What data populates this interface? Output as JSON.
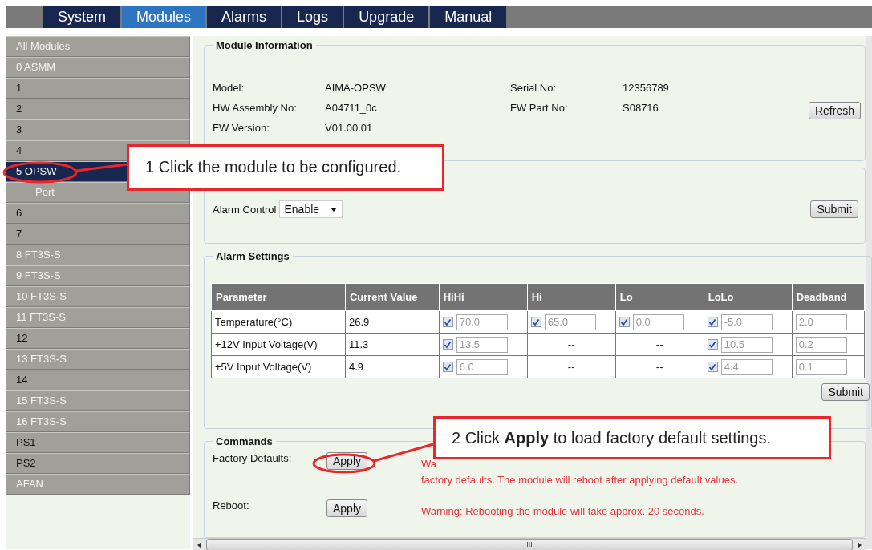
{
  "tabs": [
    {
      "label": "System",
      "selected": false
    },
    {
      "label": "Modules",
      "selected": true
    },
    {
      "label": "Alarms",
      "selected": false
    },
    {
      "label": "Logs",
      "selected": false
    },
    {
      "label": "Upgrade",
      "selected": false
    },
    {
      "label": "Manual",
      "selected": false
    }
  ],
  "sidebar": {
    "items": [
      {
        "label": "All Modules",
        "present": true,
        "selected": false
      },
      {
        "label": "0 ASMM",
        "present": true,
        "selected": false
      },
      {
        "label": "1",
        "present": false,
        "selected": false
      },
      {
        "label": "2",
        "present": false,
        "selected": false
      },
      {
        "label": "3",
        "present": false,
        "selected": false
      },
      {
        "label": "4",
        "present": false,
        "selected": false
      },
      {
        "label": "5 OPSW",
        "present": true,
        "selected": true,
        "children": [
          {
            "label": "Port",
            "present": true,
            "selected": false
          }
        ]
      },
      {
        "label": "6",
        "present": false,
        "selected": false
      },
      {
        "label": "7",
        "present": false,
        "selected": false
      },
      {
        "label": "8 FT3S-S",
        "present": true,
        "selected": false
      },
      {
        "label": "9 FT3S-S",
        "present": true,
        "selected": false
      },
      {
        "label": "10 FT3S-S",
        "present": true,
        "selected": false
      },
      {
        "label": "11 FT3S-S",
        "present": true,
        "selected": false
      },
      {
        "label": "12",
        "present": false,
        "selected": false
      },
      {
        "label": "13 FT3S-S",
        "present": true,
        "selected": false
      },
      {
        "label": "14",
        "present": false,
        "selected": false
      },
      {
        "label": "15 FT3S-S",
        "present": true,
        "selected": false
      },
      {
        "label": "16 FT3S-S",
        "present": true,
        "selected": false
      },
      {
        "label": "PS1",
        "present": false,
        "selected": false
      },
      {
        "label": "PS2",
        "present": false,
        "selected": false
      },
      {
        "label": "AFAN",
        "present": true,
        "selected": false
      }
    ]
  },
  "module_information": {
    "title": "Module Information",
    "fields": [
      {
        "label": "Model:",
        "value": "AIMA-OPSW"
      },
      {
        "label": "Serial No:",
        "value": "12356789"
      },
      {
        "label": "HW Assembly No:",
        "value": "A04711_0c"
      },
      {
        "label": "FW Part No:",
        "value": "S08716"
      },
      {
        "label": "FW Version:",
        "value": "V01.00.01"
      }
    ],
    "button": "Refresh"
  },
  "alarm_control": {
    "label": "Alarm Control",
    "value": "Enable",
    "button": "Submit"
  },
  "alarm_settings": {
    "title": "Alarm Settings",
    "columns": [
      "Parameter",
      "Current Value",
      "HiHi",
      "Hi",
      "Lo",
      "LoLo",
      "Deadband"
    ],
    "rows": [
      {
        "parameter": "Temperature(°C)",
        "current": "26.9",
        "thresholds": [
          {
            "kind": "limit",
            "checked": true,
            "value": "70.0"
          },
          {
            "kind": "limit",
            "checked": true,
            "value": "65.0"
          },
          {
            "kind": "limit",
            "checked": true,
            "value": "0.0"
          },
          {
            "kind": "limit",
            "checked": true,
            "value": "-5.0"
          }
        ],
        "deadband": "2.0"
      },
      {
        "parameter": "+12V Input Voltage(V)",
        "current": "11.3",
        "thresholds": [
          {
            "kind": "limit",
            "checked": true,
            "value": "13.5"
          },
          {
            "kind": "none",
            "text": "--"
          },
          {
            "kind": "none",
            "text": "--"
          },
          {
            "kind": "limit",
            "checked": true,
            "value": "10.5"
          }
        ],
        "deadband": "0.2"
      },
      {
        "parameter": "+5V Input Voltage(V)",
        "current": "4.9",
        "thresholds": [
          {
            "kind": "limit",
            "checked": true,
            "value": "6.0"
          },
          {
            "kind": "none",
            "text": "--"
          },
          {
            "kind": "none",
            "text": "--"
          },
          {
            "kind": "limit",
            "checked": true,
            "value": "4.4"
          }
        ],
        "deadband": "0.1"
      }
    ],
    "button": "Submit"
  },
  "commands": {
    "title": "Commands",
    "items": [
      {
        "label": "Factory Defaults:",
        "button": "Apply",
        "warning": [
          "Wa",
          "factory defaults. The module will reboot after applying default values."
        ]
      },
      {
        "label": "Reboot:",
        "button": "Apply",
        "warning": [
          "Warning: Rebooting the module will take approx. 20 seconds."
        ]
      }
    ]
  },
  "callouts": [
    {
      "text": "1 Click the module to be configured."
    },
    {
      "text": "2 Click **Apply** to load factory default settings."
    }
  ],
  "horizontal_scrollbar": {
    "grip": "III"
  }
}
